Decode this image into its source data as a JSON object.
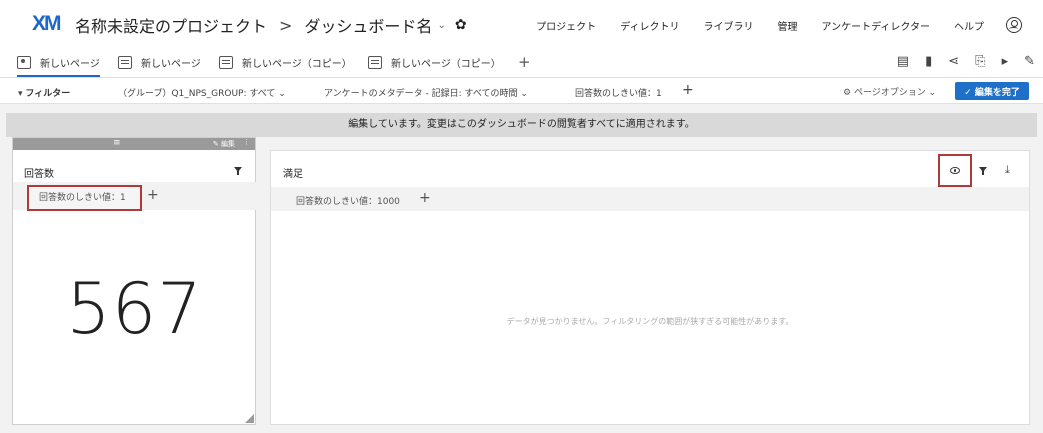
{
  "app": {
    "logo": "XM",
    "project_title": "名称未設定のプロジェクト",
    "separator": ">",
    "dashboard_name": "ダッシュボード名"
  },
  "nav": {
    "items": [
      "プロジェクト",
      "ディレクトリ",
      "ライブラリ",
      "管理",
      "アンケートディレクター",
      "ヘルプ"
    ]
  },
  "tabs": [
    {
      "label": "新しいページ",
      "active": true
    },
    {
      "label": "新しいページ",
      "active": false
    },
    {
      "label": "新しいページ（コピー）",
      "active": false
    },
    {
      "label": "新しいページ（コピー）",
      "active": false
    }
  ],
  "tab_add": "+",
  "filters": {
    "label": "フィルター",
    "group_filter": "（グループ）Q1_NPS_GROUP: すべて",
    "meta_filter": "アンケートのメタデータ - 記録日: すべての時間",
    "threshold": "回答数のしきい値：1",
    "add": "+"
  },
  "page_options": "ページオプション",
  "done_button": "✓ 編集を完了",
  "banner": "編集しています。変更はこのダッシュボードの閲覧者すべてに適用されます。",
  "widget1": {
    "edit_label": "編集",
    "title": "回答数",
    "threshold_chip": "回答数のしきい値：1",
    "add": "+",
    "value": "567"
  },
  "widget2": {
    "title": "満足",
    "threshold_chip": "回答数のしきい値：1000",
    "add": "+",
    "empty_message": "データが見つかりません。フィルタリングの範囲が狭すぎる可能性があります。"
  },
  "colors": {
    "brand": "#1e66c8",
    "done_button": "#1e6fc8",
    "highlight_border": "#b03a3a"
  }
}
